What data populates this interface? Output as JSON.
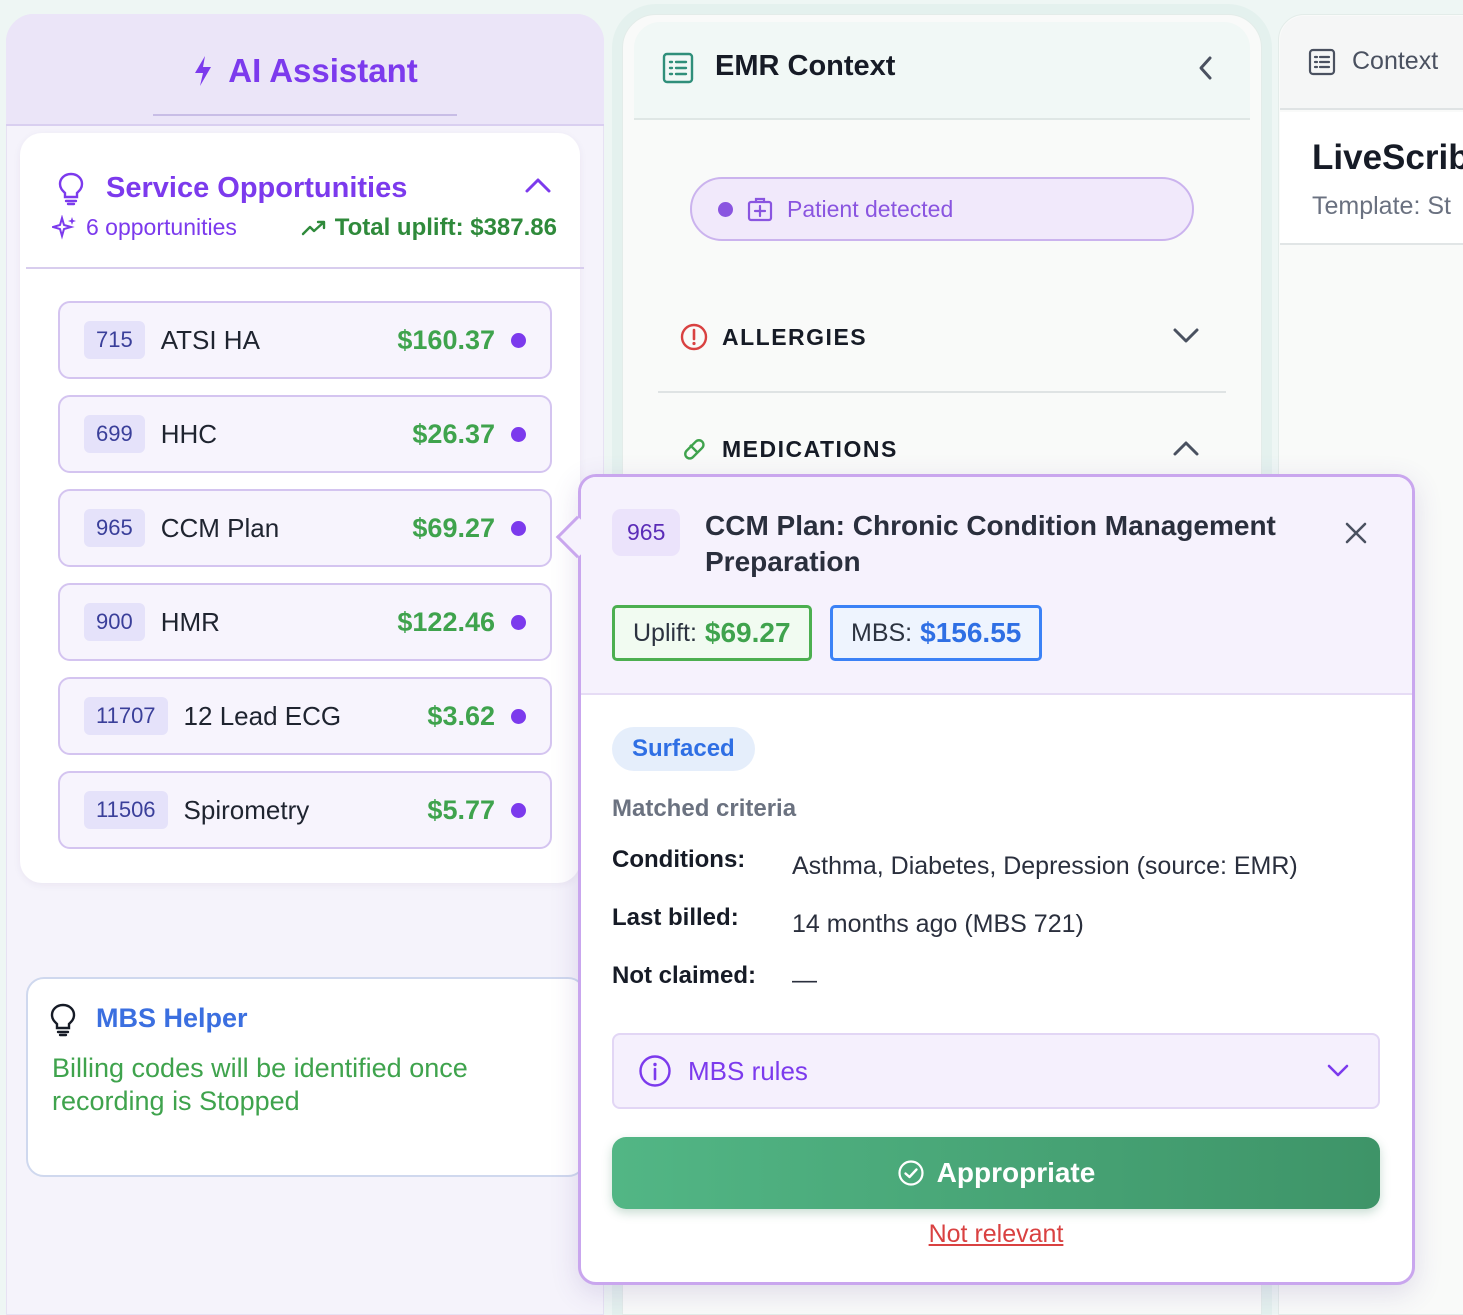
{
  "ai_panel": {
    "title": "AI Assistant",
    "service_opportunities": {
      "title": "Service Opportunities",
      "count": "6 opportunities",
      "total_uplift": "Total uplift: $387.86",
      "items": [
        {
          "code": "715",
          "name": "ATSI HA",
          "value": "$160.37"
        },
        {
          "code": "699",
          "name": "HHC",
          "value": "$26.37"
        },
        {
          "code": "965",
          "name": "CCM Plan",
          "value": "$69.27"
        },
        {
          "code": "900",
          "name": "HMR",
          "value": "$122.46"
        },
        {
          "code": "11707",
          "name": "12 Lead ECG",
          "value": "$3.62"
        },
        {
          "code": "11506",
          "name": "Spirometry",
          "value": "$5.77"
        }
      ]
    },
    "mbs_helper": {
      "title": "MBS Helper",
      "text": "Billing codes will be identified once recording is Stopped"
    }
  },
  "emr_panel": {
    "title": "EMR Context",
    "patient_status": "Patient detected",
    "sections": {
      "allergies": "ALLERGIES",
      "medications": "MEDICATIONS"
    }
  },
  "context_panel": {
    "tab": "Context",
    "title": "LiveScrib",
    "template": "Template: St"
  },
  "popover": {
    "code": "965",
    "title": "CCM Plan: Chronic Condition Management Preparation",
    "uplift_label": "Uplift:",
    "uplift_value": "$69.27",
    "mbs_label": "MBS:",
    "mbs_value": "$156.55",
    "status": "Surfaced",
    "matched_heading": "Matched criteria",
    "criteria": {
      "conditions_label": "Conditions:",
      "conditions_value": "Asthma, Diabetes, Depression (source: EMR)",
      "last_billed_label": "Last billed:",
      "last_billed_value": "14 months ago (MBS 721)",
      "not_claimed_label": "Not claimed:",
      "not_claimed_value": "—"
    },
    "rules_label": "MBS rules",
    "appropriate_label": "Appropriate",
    "not_relevant_label": "Not relevant"
  },
  "colors": {
    "accent_purple": "#7c3aed",
    "success_green": "#3fa34d",
    "mbs_blue": "#2f6fe4",
    "danger_red": "#d94141"
  }
}
